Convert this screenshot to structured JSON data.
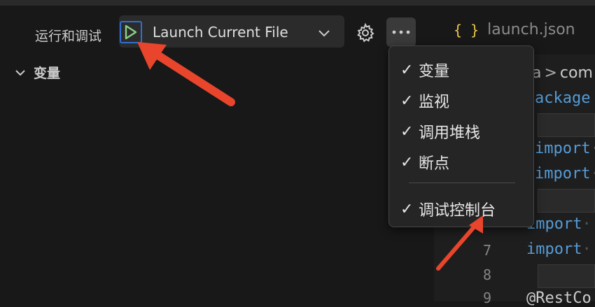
{
  "sidebar": {
    "title": "运行和调试",
    "launch_config": "Launch Current File",
    "variables_section": "变量",
    "icons": [
      "play-icon",
      "chevron-down-icon",
      "gear-icon",
      "more-icon",
      "chevron-down-icon"
    ]
  },
  "menu": {
    "items": [
      {
        "label": "变量",
        "checked": true
      },
      {
        "label": "监视",
        "checked": true
      },
      {
        "label": "调用堆栈",
        "checked": true
      },
      {
        "label": "断点",
        "checked": true
      },
      {
        "label": "调试控制台",
        "checked": true
      }
    ],
    "check_glyph": "✓"
  },
  "editor": {
    "tab": {
      "icon": "{ }",
      "label": "launch.json"
    },
    "breadcrumb": {
      "part1": "a",
      "separator": ">",
      "part2": "com"
    },
    "line_numbers": [
      "7",
      "8",
      "9"
    ],
    "code_lines": [
      {
        "text": "ackage"
      },
      {
        "text": "import"
      },
      {
        "text": "import"
      },
      {
        "text": "import"
      },
      {
        "text": "import"
      },
      {
        "text": "@RestCo"
      }
    ],
    "middle_dot": "·"
  },
  "colors": {
    "accent_blue": "#2f6fd1",
    "play_green": "#89d185",
    "annotation_red": "#e8452c",
    "keyword_blue": "#569cd6",
    "json_icon_yellow": "#e8c84a"
  }
}
